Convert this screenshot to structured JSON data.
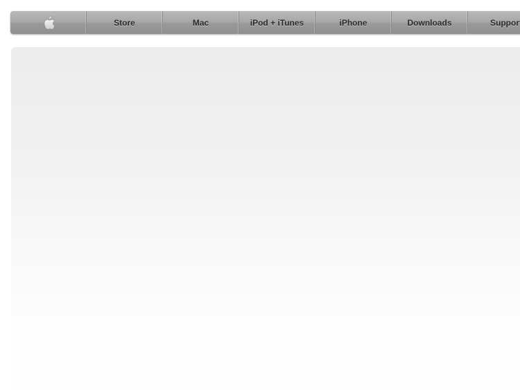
{
  "globalnav": {
    "logo_icon": "apple-logo-icon",
    "items": [
      {
        "label": "Store"
      },
      {
        "label": "Mac"
      },
      {
        "label": "iPod + iTunes"
      },
      {
        "label": "iPhone"
      },
      {
        "label": "Downloads"
      },
      {
        "label": "Support"
      }
    ]
  },
  "colors": {
    "nav_text": "#2b2b2b",
    "nav_bar": "#a8a8a8",
    "hero_top": "#ececec",
    "hero_bottom": "#ffffff"
  }
}
